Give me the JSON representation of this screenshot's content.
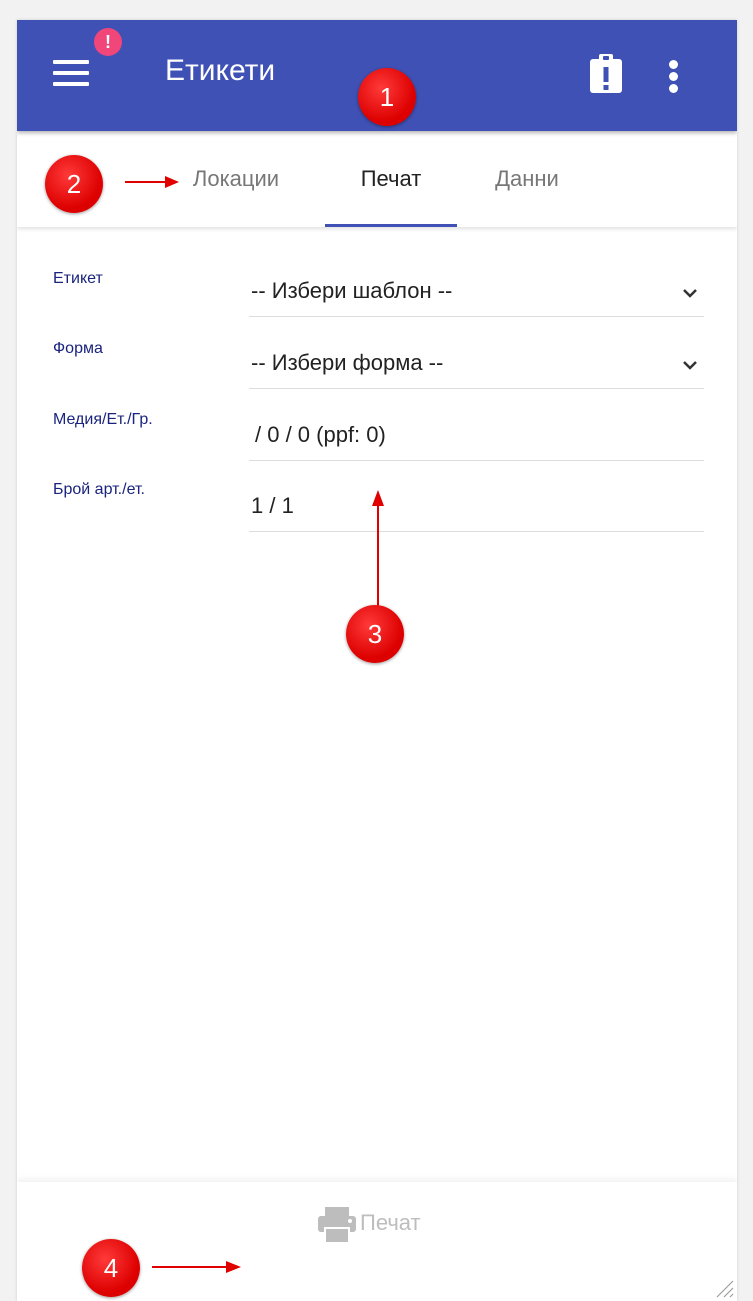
{
  "app_bar": {
    "title": "Етикети",
    "notification_badge": "!",
    "background_color": "#3f51b5",
    "badge_color": "#f0467a"
  },
  "tabs": [
    {
      "label": "Локации",
      "active": false
    },
    {
      "label": "Печат",
      "active": true
    },
    {
      "label": "Данни",
      "active": false
    }
  ],
  "form": {
    "label_template": {
      "label": "Етикет",
      "value": "-- Избери шаблон --"
    },
    "form": {
      "label": "Форма",
      "value": "-- Избери форма --"
    },
    "media": {
      "label": "Медия/Ет./Гр.",
      "value": "/ 0 / 0 (ppf: 0)"
    },
    "count": {
      "label": "Брой арт./ет.",
      "value": "1 / 1"
    }
  },
  "bottom_bar": {
    "print_label": "Печат"
  },
  "annotations": {
    "marker_1": "1",
    "marker_2": "2",
    "marker_3": "3",
    "marker_4": "4",
    "color": "#e00000"
  },
  "icons": [
    "menu-icon",
    "clipboard-alert-icon",
    "more-vert-icon",
    "chevron-down-icon",
    "printer-icon",
    "resize-grip-icon"
  ]
}
